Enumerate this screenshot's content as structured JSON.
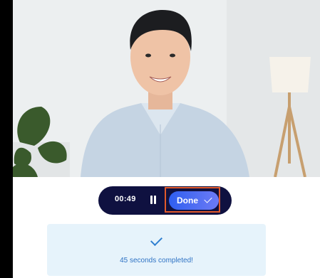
{
  "video": {
    "description_icon": "person-on-video-call"
  },
  "recorder": {
    "elapsed_time": "00:49",
    "pause_icon": "pause-icon",
    "done_label": "Done",
    "done_icon": "check-icon",
    "accent_colors": [
      "#2f5ff0",
      "#6d7bf5"
    ],
    "bar_color": "#0f1140"
  },
  "status_card": {
    "icon": "check-icon",
    "message": "45 seconds completed!"
  }
}
